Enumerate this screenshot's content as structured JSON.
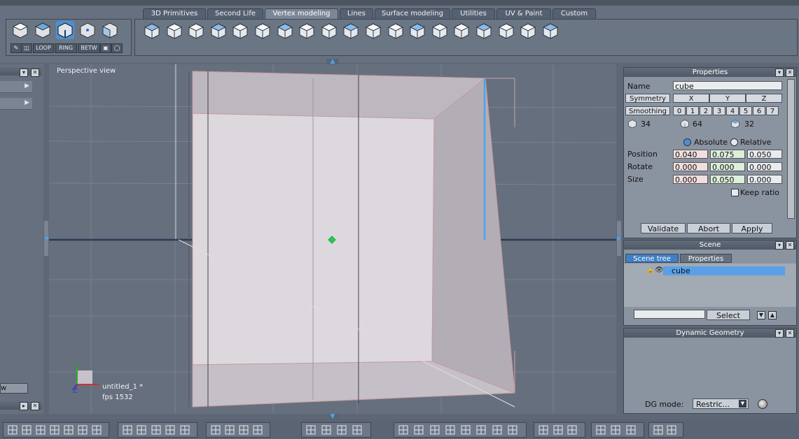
{
  "tabs": [
    {
      "label": "3D Primitives",
      "active": false
    },
    {
      "label": "Second Life",
      "active": false
    },
    {
      "label": "Vertex modeling",
      "active": true
    },
    {
      "label": "Lines",
      "active": false
    },
    {
      "label": "Surface modeling",
      "active": false
    },
    {
      "label": "Utilities",
      "active": false
    },
    {
      "label": "UV & Paint",
      "active": false
    },
    {
      "label": "Custom",
      "active": false
    }
  ],
  "mode_buttons": {
    "loop": "LOOP",
    "ring": "RING",
    "betw": "BETW"
  },
  "viewport": {
    "title": "Perspective view",
    "file": "untitled_1 *",
    "fps": "fps 1532",
    "axis_y": "Y",
    "axis_z": "Z"
  },
  "left_panel": {
    "bottom_label": "w"
  },
  "properties": {
    "title": "Properties",
    "name_label": "Name",
    "name_value": "cube",
    "symmetry_label": "Symmetry",
    "axes": [
      "X",
      "Y",
      "Z"
    ],
    "smoothing_label": "Smoothing",
    "smoothing_levels": [
      "0",
      "1",
      "2",
      "3",
      "4",
      "5",
      "6",
      "7"
    ],
    "counts": [
      "34",
      "64",
      "32"
    ],
    "absolute_label": "Absolute",
    "relative_label": "Relative",
    "position_label": "Position",
    "position": [
      "0.040",
      "0.075",
      "0.050"
    ],
    "rotate_label": "Rotate",
    "rotate": [
      "0.000",
      "0.000",
      "0.000"
    ],
    "size_label": "Size",
    "size": [
      "0.000",
      "0.050",
      "0.000"
    ],
    "keep_ratio_label": "Keep ratio",
    "validate": "Validate",
    "abort": "Abort",
    "apply": "Apply"
  },
  "scene": {
    "title": "Scene",
    "tab_tree": "Scene tree",
    "tab_properties": "Properties",
    "item": "cube",
    "select": "Select"
  },
  "dynamic_geometry": {
    "title": "Dynamic Geometry",
    "dg_mode_label": "DG mode:",
    "dg_mode_value": "Restric..."
  },
  "colors": {
    "accent": "#4a90d9",
    "selection": "#5ba0e6",
    "background": "#5d6775"
  }
}
